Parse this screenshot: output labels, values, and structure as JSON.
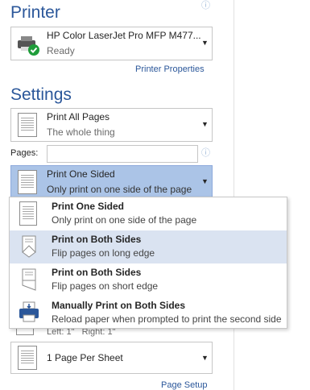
{
  "printer": {
    "heading": "Printer",
    "name": "HP Color LaserJet Pro MFP M477...",
    "status": "Ready",
    "properties_link": "Printer Properties"
  },
  "settings": {
    "heading": "Settings",
    "pages_dropdown": {
      "title": "Print All Pages",
      "subtitle": "The whole thing"
    },
    "pages_label": "Pages:",
    "pages_value": "",
    "sided_dropdown": {
      "title": "Print One Sided",
      "subtitle": "Only print on one side of the page"
    },
    "margins_partial": "Left: 1\"   Right: 1\"",
    "per_sheet": "1 Page Per Sheet",
    "page_setup_link": "Page Setup"
  },
  "menu": {
    "items": [
      {
        "title": "Print One Sided",
        "subtitle": "Only print on one side of the page"
      },
      {
        "title": "Print on Both Sides",
        "subtitle": "Flip pages on long edge"
      },
      {
        "title": "Print on Both Sides",
        "subtitle": "Flip pages on short edge"
      },
      {
        "title": "Manually Print on Both Sides",
        "subtitle": "Reload paper when prompted to print the second side"
      }
    ]
  },
  "colors": {
    "accent": "#2b579a",
    "selected": "#abc4e7",
    "hover": "#dae3f1",
    "ready_green": "#1f9d3a"
  }
}
